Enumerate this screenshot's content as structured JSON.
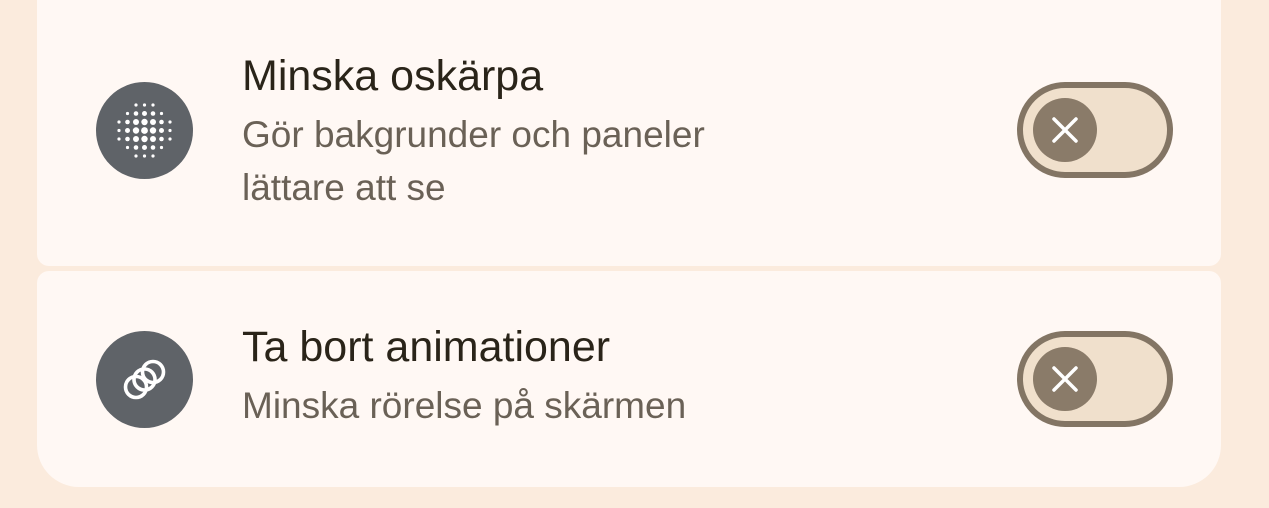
{
  "settings": [
    {
      "title": "Minska oskärpa",
      "subtitle_lines": [
        "Gör bakgrunder och paneler",
        "lättare att se"
      ],
      "icon": "blur-dots-icon",
      "toggle_on": false
    },
    {
      "title": "Ta bort animationer",
      "subtitle_lines": [
        "Minska rörelse på skärmen"
      ],
      "icon": "rings-icon",
      "toggle_on": false
    }
  ],
  "colors": {
    "background": "#FBEBDD",
    "card": "#FFF8F4",
    "icon_circle": "#5F6368",
    "toggle_track": "#F0E0CC",
    "toggle_border": "#837564",
    "toggle_thumb": "#8A7B69"
  }
}
